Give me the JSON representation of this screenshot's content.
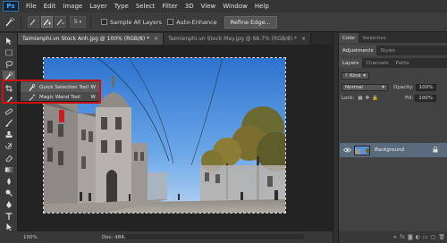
{
  "app": {
    "logo": "Ps"
  },
  "menu": [
    "File",
    "Edit",
    "Image",
    "Layer",
    "Type",
    "Select",
    "Filter",
    "3D",
    "View",
    "Window",
    "Help"
  ],
  "options": {
    "brush_size": "5",
    "sample_all_layers": "Sample All Layers",
    "auto_enhance": "Auto-Enhance",
    "refine_edge": "Refine Edge..."
  },
  "tabs": [
    {
      "label": "Taimienphi.vn Stock Anh.jpg @ 100% (RGB/8) *",
      "close": "×"
    },
    {
      "label": "Taimienphi.vn Stock May.jpg @ 66.7% (RGB/8) *",
      "close": "×"
    }
  ],
  "flyout": {
    "items": [
      {
        "label": "Quick Selection Tool",
        "key": "W"
      },
      {
        "label": "Magic Wand Tool",
        "key": "W"
      }
    ]
  },
  "status": {
    "zoom": "100%",
    "doc": "Doc: 484.9K/484.9K",
    "arrow": "▶"
  },
  "panels": {
    "group1_tabs": [
      "Color",
      "Swatches"
    ],
    "group2_tabs": [
      "Adjustments",
      "Styles"
    ],
    "layers_tabs": [
      "Layers",
      "Channels",
      "Paths"
    ],
    "kind": "Kind",
    "blend_mode": "Normal",
    "opacity_label": "Opacity:",
    "opacity_value": "100%",
    "lock_label": "Lock:",
    "fill_label": "Fill:",
    "fill_value": "100%",
    "layer_name": "Background"
  },
  "colors": {
    "highlight": "#d01010",
    "sky": "#3f86d8",
    "accent": "#2a76b8"
  }
}
